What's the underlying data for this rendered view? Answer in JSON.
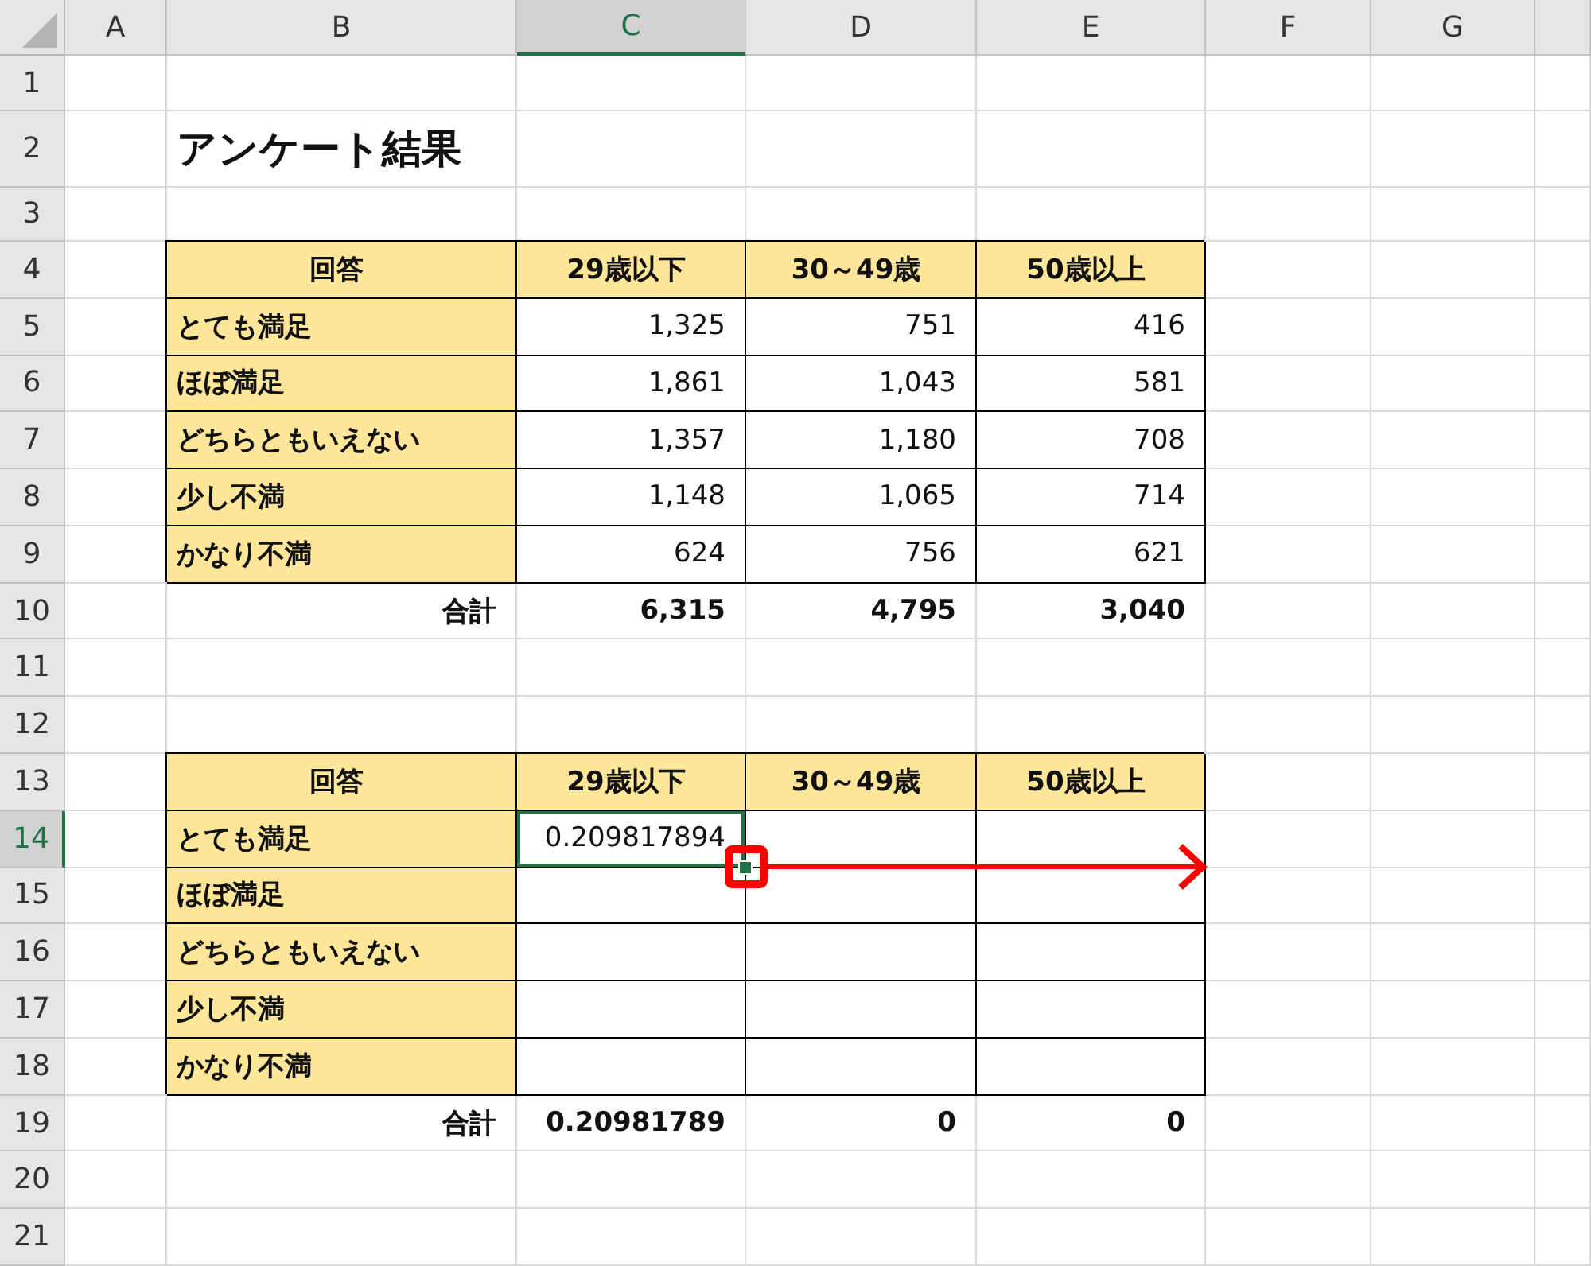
{
  "column_headers": [
    {
      "label": "A",
      "selected": false
    },
    {
      "label": "B",
      "selected": false
    },
    {
      "label": "C",
      "selected": true
    },
    {
      "label": "D",
      "selected": false
    },
    {
      "label": "E",
      "selected": false
    },
    {
      "label": "F",
      "selected": false
    },
    {
      "label": "G",
      "selected": false
    }
  ],
  "row_headers": [
    {
      "label": "1",
      "selected": false
    },
    {
      "label": "2",
      "selected": false
    },
    {
      "label": "3",
      "selected": false
    },
    {
      "label": "4",
      "selected": false
    },
    {
      "label": "5",
      "selected": false
    },
    {
      "label": "6",
      "selected": false
    },
    {
      "label": "7",
      "selected": false
    },
    {
      "label": "8",
      "selected": false
    },
    {
      "label": "9",
      "selected": false
    },
    {
      "label": "10",
      "selected": false
    },
    {
      "label": "11",
      "selected": false
    },
    {
      "label": "12",
      "selected": false
    },
    {
      "label": "13",
      "selected": false
    },
    {
      "label": "14",
      "selected": true
    },
    {
      "label": "15",
      "selected": false
    },
    {
      "label": "16",
      "selected": false
    },
    {
      "label": "17",
      "selected": false
    },
    {
      "label": "18",
      "selected": false
    },
    {
      "label": "19",
      "selected": false
    },
    {
      "label": "20",
      "selected": false
    },
    {
      "label": "21",
      "selected": false
    }
  ],
  "title": "アンケート結果",
  "tables": [
    {
      "header": [
        "回答",
        "29歳以下",
        "30～49歳",
        "50歳以上"
      ],
      "rows": [
        {
          "label": "とても満足",
          "cells": [
            {
              "text": "1,325",
              "selected": false
            },
            {
              "text": "751",
              "selected": false
            },
            {
              "text": "416",
              "selected": false
            }
          ]
        },
        {
          "label": "ほぼ満足",
          "cells": [
            {
              "text": "1,861",
              "selected": false
            },
            {
              "text": "1,043",
              "selected": false
            },
            {
              "text": "581",
              "selected": false
            }
          ]
        },
        {
          "label": "どちらともいえない",
          "cells": [
            {
              "text": "1,357",
              "selected": false
            },
            {
              "text": "1,180",
              "selected": false
            },
            {
              "text": "708",
              "selected": false
            }
          ]
        },
        {
          "label": "少し不満",
          "cells": [
            {
              "text": "1,148",
              "selected": false
            },
            {
              "text": "1,065",
              "selected": false
            },
            {
              "text": "714",
              "selected": false
            }
          ]
        },
        {
          "label": "かなり不満",
          "cells": [
            {
              "text": "624",
              "selected": false
            },
            {
              "text": "756",
              "selected": false
            },
            {
              "text": "621",
              "selected": false
            }
          ]
        }
      ],
      "total": {
        "label": "合計",
        "values": [
          "6,315",
          "4,795",
          "3,040"
        ]
      }
    },
    {
      "header": [
        "回答",
        "29歳以下",
        "30～49歳",
        "50歳以上"
      ],
      "rows": [
        {
          "label": "とても満足",
          "cells": [
            {
              "text": "0.209817894",
              "selected": true
            },
            {
              "selected": false
            },
            {
              "selected": false
            }
          ]
        },
        {
          "label": "ほぼ満足",
          "cells": [
            {
              "selected": false
            },
            {
              "selected": false
            },
            {
              "selected": false
            }
          ]
        },
        {
          "label": "どちらともいえない",
          "cells": [
            {
              "selected": false
            },
            {
              "selected": false
            },
            {
              "selected": false
            }
          ]
        },
        {
          "label": "少し不満",
          "cells": [
            {
              "selected": false
            },
            {
              "selected": false
            },
            {
              "selected": false
            }
          ]
        },
        {
          "label": "かなり不満",
          "cells": [
            {
              "selected": false
            },
            {
              "selected": false
            },
            {
              "selected": false
            }
          ]
        }
      ],
      "total": {
        "label": "合計",
        "values": [
          "0.20981789",
          "0",
          "0"
        ]
      }
    }
  ]
}
